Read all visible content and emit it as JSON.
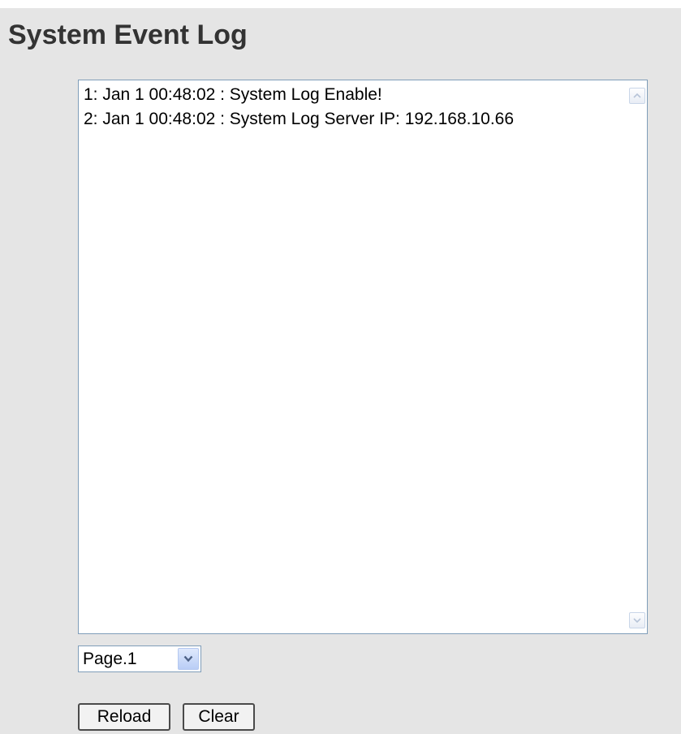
{
  "header": {
    "title": "System Event Log"
  },
  "log": {
    "lines": [
      "1: Jan 1 00:48:02 : System Log Enable!",
      "2: Jan 1 00:48:02 : System Log Server IP: 192.168.10.66"
    ]
  },
  "page_select": {
    "selected": "Page.1"
  },
  "buttons": {
    "reload_label": "Reload",
    "clear_label": "Clear"
  },
  "icons": {
    "scroll_up": "chevron-up-icon",
    "scroll_down": "chevron-down-icon",
    "dropdown": "chevron-down-icon"
  },
  "colors": {
    "page_background": "#e5e5e5",
    "title_text": "#333333",
    "field_border": "#7f9db9"
  }
}
